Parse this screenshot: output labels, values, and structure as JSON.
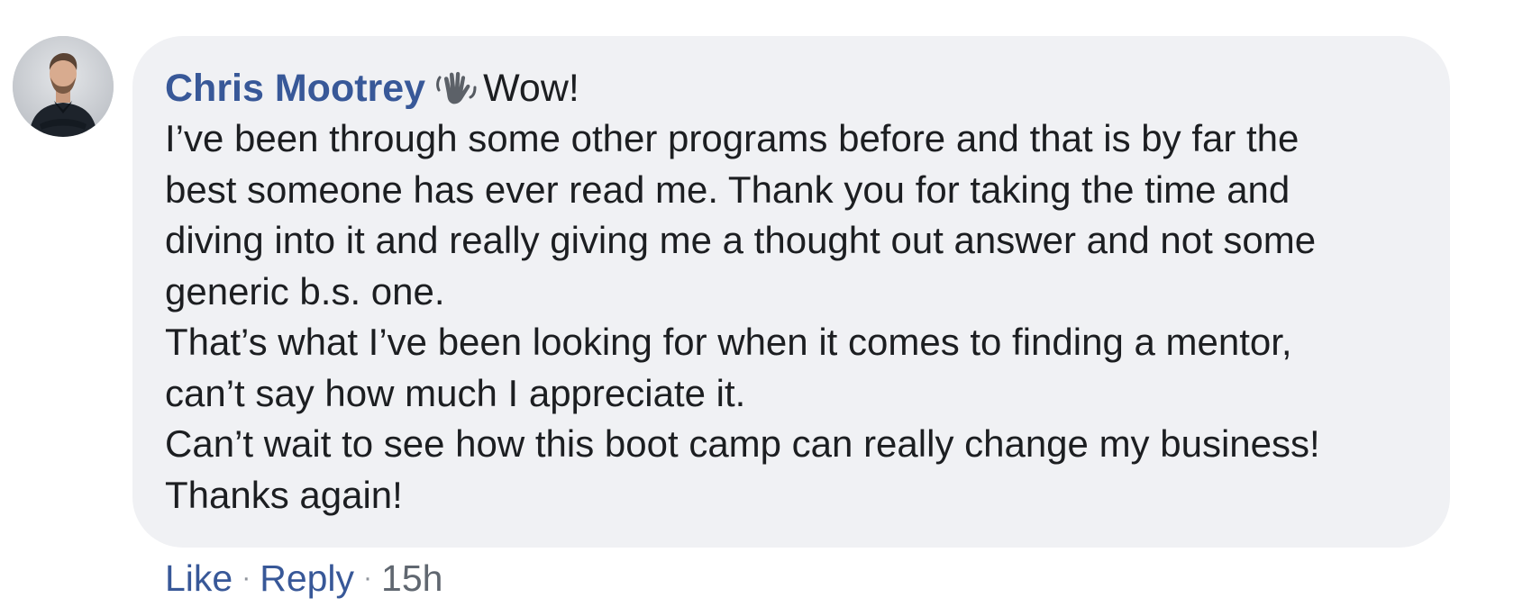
{
  "comment": {
    "author": "Chris Mootrey",
    "emoji": "waving-hand",
    "opener": "Wow!",
    "lines": [
      "I’ve been through some other programs before and that is by far the",
      "best someone has ever read me. Thank you for taking the time and",
      "diving into it and really giving me a thought out answer and not some",
      "generic b.s. one.",
      "That’s what I’ve been looking for when it comes to finding a mentor,",
      "can’t say how much I appreciate it.",
      "Can’t wait to see how this boot camp can really change my business!",
      "Thanks again!"
    ]
  },
  "actions": {
    "like_label": "Like",
    "separator": "·",
    "reply_label": "Reply",
    "timestamp": "15h"
  },
  "colors": {
    "author_link": "#385898",
    "bubble_background": "#f0f1f4",
    "body_text": "#1c1e21",
    "timestamp_text": "#606770"
  }
}
